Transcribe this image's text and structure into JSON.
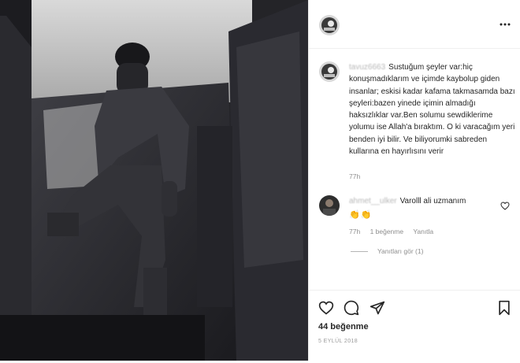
{
  "post": {
    "username": "tavuz6663",
    "caption": "Sustuğum şeyler var:hiç konuşmadıklarım ve içimde kaybolup giden insanlar; eskisi kadar kafama takmasamda bazı şeyleri:bazen yinede içimin almadığı haksızlıklar var.Ben solumu sewdiklerime yolumu ise Allah'a bıraktım. O ki varacağım yeri benden iyi bilir. Ve biliyorumki sabreden kullarına en hayırlısını verir",
    "caption_time": "77h",
    "likes": "44 beğenme",
    "date": "5 EYLÜL 2018"
  },
  "comment": {
    "username": "ahmet__ulker",
    "text": "Varolll ali uzmanım",
    "emoji": "👏👏",
    "time": "77h",
    "likes": "1 beğenme",
    "reply": "Yanıtla",
    "view_replies": "Yanıtları gör (1)"
  },
  "icons": {
    "more": "more-options-icon",
    "like": "heart-icon",
    "comment": "comment-icon",
    "share": "share-icon",
    "save": "bookmark-icon",
    "comment_like": "heart-outline-icon"
  },
  "colors": {
    "text": "#262626",
    "muted": "#8e8e8e",
    "border": "#efefef"
  }
}
